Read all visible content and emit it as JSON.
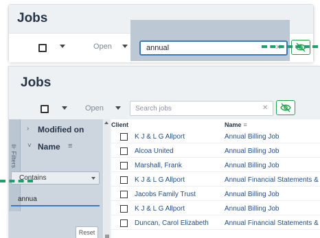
{
  "page": {
    "title": "Jobs"
  },
  "toolbar": {
    "status_filter": "Open",
    "search_value": "annual",
    "search_placeholder": "Search jobs",
    "clear_glyph": "✕"
  },
  "filters": {
    "tab_label": "⊪ Filters",
    "items": [
      {
        "label": "Modified on",
        "chevron": "›"
      },
      {
        "label": "Name",
        "chevron": "˅"
      }
    ],
    "sort_glyph": "≡",
    "operator": "Contains",
    "value": "annua",
    "reset_label": "Reset"
  },
  "table": {
    "columns": {
      "client": "Client",
      "name": "Name",
      "sort_glyph": "≡"
    },
    "rows": [
      {
        "client": "K J & L G Allport",
        "name": "Annual Billing Job"
      },
      {
        "client": "Alcoa United",
        "name": "Annual Billing Job"
      },
      {
        "client": "Marshall, Frank",
        "name": "Annual Billing Job"
      },
      {
        "client": "K J & L G Allport",
        "name": "Annual Financial Statements & Tax"
      },
      {
        "client": "Jacobs Family Trust",
        "name": "Annual Billing Job"
      },
      {
        "client": "K J & L G Allport",
        "name": "Annual Billing Job"
      },
      {
        "client": "Duncan, Carol Elizabeth",
        "name": "Annual Financial Statements & Tax"
      }
    ]
  },
  "colors": {
    "accent_blue": "#3b78c3",
    "toggle_green": "#22a34b",
    "connector_green": "#1e9e6a",
    "link_blue": "#1f4e8c"
  },
  "icons": {
    "checkbox": "checkbox-icon",
    "caret": "caret-down-icon",
    "clear": "clear-icon",
    "visibility_toggle": "eye-off-icon"
  }
}
